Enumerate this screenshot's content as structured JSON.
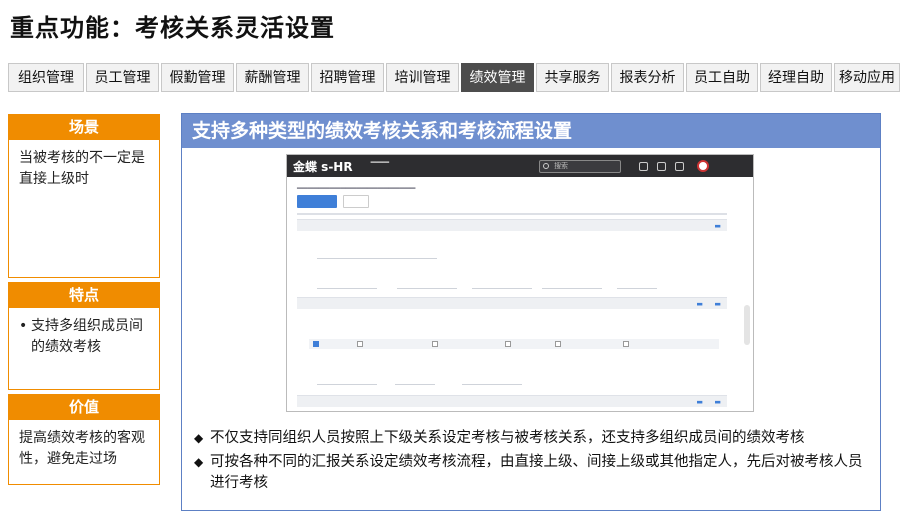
{
  "page_title": "重点功能：考核关系灵活设置",
  "nav": {
    "items": [
      "组织管理",
      "员工管理",
      "假勤管理",
      "薪酬管理",
      "招聘管理",
      "培训管理",
      "绩效管理",
      "共享服务",
      "报表分析",
      "员工自助",
      "经理自助",
      "移动应用"
    ],
    "active_index": 6
  },
  "sidebar": {
    "scene": {
      "heading": "场景",
      "text": "当被考核的不一定是直接上级时"
    },
    "feature": {
      "heading": "特点",
      "bullet": "•",
      "text": "支持多组织成员间的绩效考核"
    },
    "value": {
      "heading": "价值",
      "text": "提高绩效考核的客观性，避免走过场"
    }
  },
  "main": {
    "heading": "支持多种类型的绩效考核关系和考核流程设置",
    "screenshot": {
      "logo": "金蝶 s-HR",
      "search_placeholder": "搜索"
    },
    "bullets": [
      {
        "mark": "◆",
        "text": "不仅支持同组织人员按照上下级关系设定考核与被考核关系，还支持多组织成员间的绩效考核"
      },
      {
        "mark": "◆",
        "text": "可按各种不同的汇报关系设定绩效考核流程，由直接上级、间接上级或其他指定人，先后对被考核人员进行考核"
      }
    ]
  },
  "colors": {
    "accent_orange": "#f08c00",
    "panel_blue": "#6f8fcf",
    "nav_active": "#4d4d4d"
  }
}
